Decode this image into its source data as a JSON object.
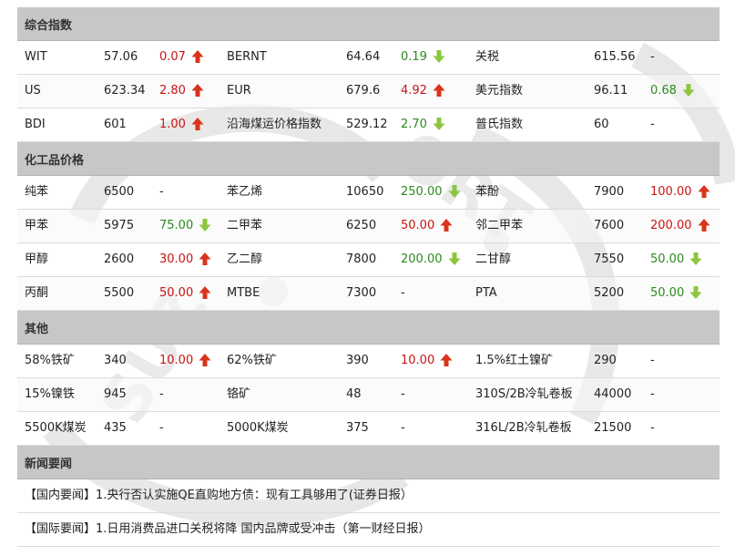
{
  "sections": [
    {
      "title": "综合指数",
      "rows": [
        [
          {
            "name": "WIT",
            "value": "57.06",
            "change": "0.07",
            "dir": "up"
          },
          {
            "name": "BERNT",
            "value": "64.64",
            "change": "0.19",
            "dir": "down"
          },
          {
            "name": "关税",
            "value": "615.56",
            "change": "-",
            "dir": "none"
          }
        ],
        [
          {
            "name": "US",
            "value": "623.34",
            "change": "2.80",
            "dir": "up"
          },
          {
            "name": "EUR",
            "value": "679.6",
            "change": "4.92",
            "dir": "up"
          },
          {
            "name": "美元指数",
            "value": "96.11",
            "change": "0.68",
            "dir": "down"
          }
        ],
        [
          {
            "name": "BDI",
            "value": "601",
            "change": "1.00",
            "dir": "up"
          },
          {
            "name": "沿海煤运价格指数",
            "value": "529.12",
            "change": "2.70",
            "dir": "down"
          },
          {
            "name": "普氏指数",
            "value": "60",
            "change": "-",
            "dir": "none"
          }
        ]
      ]
    },
    {
      "title": "化工品价格",
      "rows": [
        [
          {
            "name": "纯苯",
            "value": "6500",
            "change": "-",
            "dir": "none"
          },
          {
            "name": "苯乙烯",
            "value": "10650",
            "change": "250.00",
            "dir": "down"
          },
          {
            "name": "苯酚",
            "value": "7900",
            "change": "100.00",
            "dir": "up"
          }
        ],
        [
          {
            "name": "甲苯",
            "value": "5975",
            "change": "75.00",
            "dir": "down"
          },
          {
            "name": "二甲苯",
            "value": "6250",
            "change": "50.00",
            "dir": "up"
          },
          {
            "name": "邻二甲苯",
            "value": "7600",
            "change": "200.00",
            "dir": "up"
          }
        ],
        [
          {
            "name": "甲醇",
            "value": "2600",
            "change": "30.00",
            "dir": "up"
          },
          {
            "name": "乙二醇",
            "value": "7800",
            "change": "200.00",
            "dir": "down"
          },
          {
            "name": "二甘醇",
            "value": "7550",
            "change": "50.00",
            "dir": "down"
          }
        ],
        [
          {
            "name": "丙酮",
            "value": "5500",
            "change": "50.00",
            "dir": "up"
          },
          {
            "name": "MTBE",
            "value": "7300",
            "change": "-",
            "dir": "none"
          },
          {
            "name": "PTA",
            "value": "5200",
            "change": "50.00",
            "dir": "down"
          }
        ]
      ]
    },
    {
      "title": "其他",
      "rows": [
        [
          {
            "name": "58%铁矿",
            "value": "340",
            "change": "10.00",
            "dir": "up"
          },
          {
            "name": "62%铁矿",
            "value": "390",
            "change": "10.00",
            "dir": "up"
          },
          {
            "name": "1.5%红土镍矿",
            "value": "290",
            "change": "-",
            "dir": "none"
          }
        ],
        [
          {
            "name": "15%镍铁",
            "value": "945",
            "change": "-",
            "dir": "none"
          },
          {
            "name": "铬矿",
            "value": "48",
            "change": "-",
            "dir": "none"
          },
          {
            "name": "310S/2B冷轧卷板",
            "value": "44000",
            "change": "-",
            "dir": "none"
          }
        ],
        [
          {
            "name": "5500K煤炭",
            "value": "435",
            "change": "-",
            "dir": "none"
          },
          {
            "name": "5000K煤炭",
            "value": "375",
            "change": "-",
            "dir": "none"
          },
          {
            "name": "316L/2B冷轧卷板",
            "value": "21500",
            "change": "-",
            "dir": "none"
          }
        ]
      ]
    }
  ],
  "news": {
    "title": "新闻要闻",
    "items": [
      {
        "tag": "【国内要闻】",
        "text": "1.央行否认实施QE直购地方债：现有工具够用了(证券日报）"
      },
      {
        "tag": "【国际要闻】",
        "text": "1.日用消费品进口关税将降 国内品牌或受冲击（第一财经日报）"
      }
    ]
  },
  "watermark": "SUZHOU PORT",
  "colors": {
    "up": "#c81414",
    "down": "#2c8a1e",
    "header_bg": "#c7c7c7"
  },
  "icons": {
    "up": "red-up-arrow-icon",
    "down": "green-down-arrow-icon"
  }
}
